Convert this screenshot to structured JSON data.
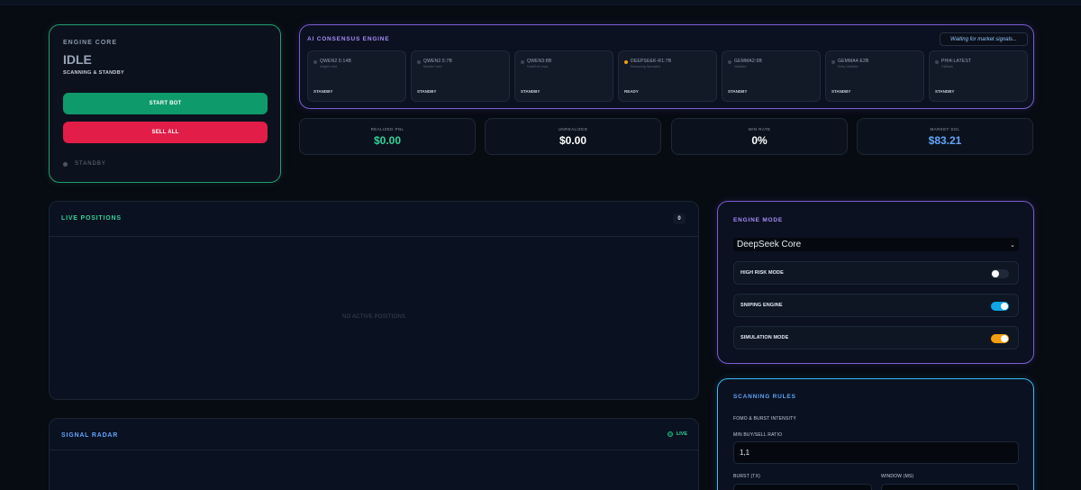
{
  "engine_core": {
    "title": "ENGINE CORE",
    "state": "IDLE",
    "subtitle": "SCANNING & STANDBY",
    "start_label": "START BOT",
    "sell_label": "SELL ALL",
    "status": "STANDBY"
  },
  "ai_consensus": {
    "title": "AI CONSENSUS ENGINE",
    "status": "Waiting for market signals...",
    "models": [
      {
        "name": "QWEN2.5:14B",
        "role": "Insight Lead",
        "state": "STANDBY",
        "active": false
      },
      {
        "name": "QWEN2.5:7B",
        "role": "Monitor Lead",
        "state": "STANDBY",
        "active": false
      },
      {
        "name": "QWEN3:8B",
        "role": "Hold/Exit Lead",
        "state": "STANDBY",
        "active": false
      },
      {
        "name": "DEEPSEEK-R1:7B",
        "role": "Reasoning Specialist",
        "state": "READY",
        "active": true
      },
      {
        "name": "GEMMA2:9B",
        "role": "Validator",
        "state": "STANDBY",
        "active": false
      },
      {
        "name": "GEMMA4:E2B",
        "role": "Entry Validator",
        "state": "STANDBY",
        "active": false
      },
      {
        "name": "PHI4:LATEST",
        "role": "Fallback",
        "state": "STANDBY",
        "active": false
      }
    ]
  },
  "stats": [
    {
      "label": "REALIZED PNL",
      "value": "$0.00",
      "color": "#34d399"
    },
    {
      "label": "UNREALIZED",
      "value": "$0.00",
      "color": "#ffffff"
    },
    {
      "label": "WIN RATE",
      "value": "0%",
      "color": "#ffffff"
    },
    {
      "label": "MARKET SOL",
      "value": "$83.21",
      "color": "#60a5fa"
    }
  ],
  "live_positions": {
    "title": "LIVE POSITIONS",
    "count": "0",
    "empty_text": "NO ACTIVE POSITIONS"
  },
  "signal_radar": {
    "title": "SIGNAL RADAR",
    "live_label": "LIVE"
  },
  "engine_mode": {
    "title": "ENGINE MODE",
    "selected_mode": "DeepSeek Core",
    "toggles": [
      {
        "label": "HIGH RISK MODE",
        "on": false,
        "color": "#1f2937"
      },
      {
        "label": "SNIPING ENGINE",
        "on": true,
        "color": "#0ea5e9"
      },
      {
        "label": "SIMULATION MODE",
        "on": true,
        "color": "#f59e0b"
      }
    ]
  },
  "scanning_rules": {
    "title": "SCANNING RULES",
    "section": "FOMO & BURST INTENSITY",
    "min_ratio_label": "MIN BUY/SELL RATIO",
    "min_ratio_value": "1,1",
    "burst_label": "BURST (TX)",
    "window_label": "WINDOW (MS)"
  }
}
